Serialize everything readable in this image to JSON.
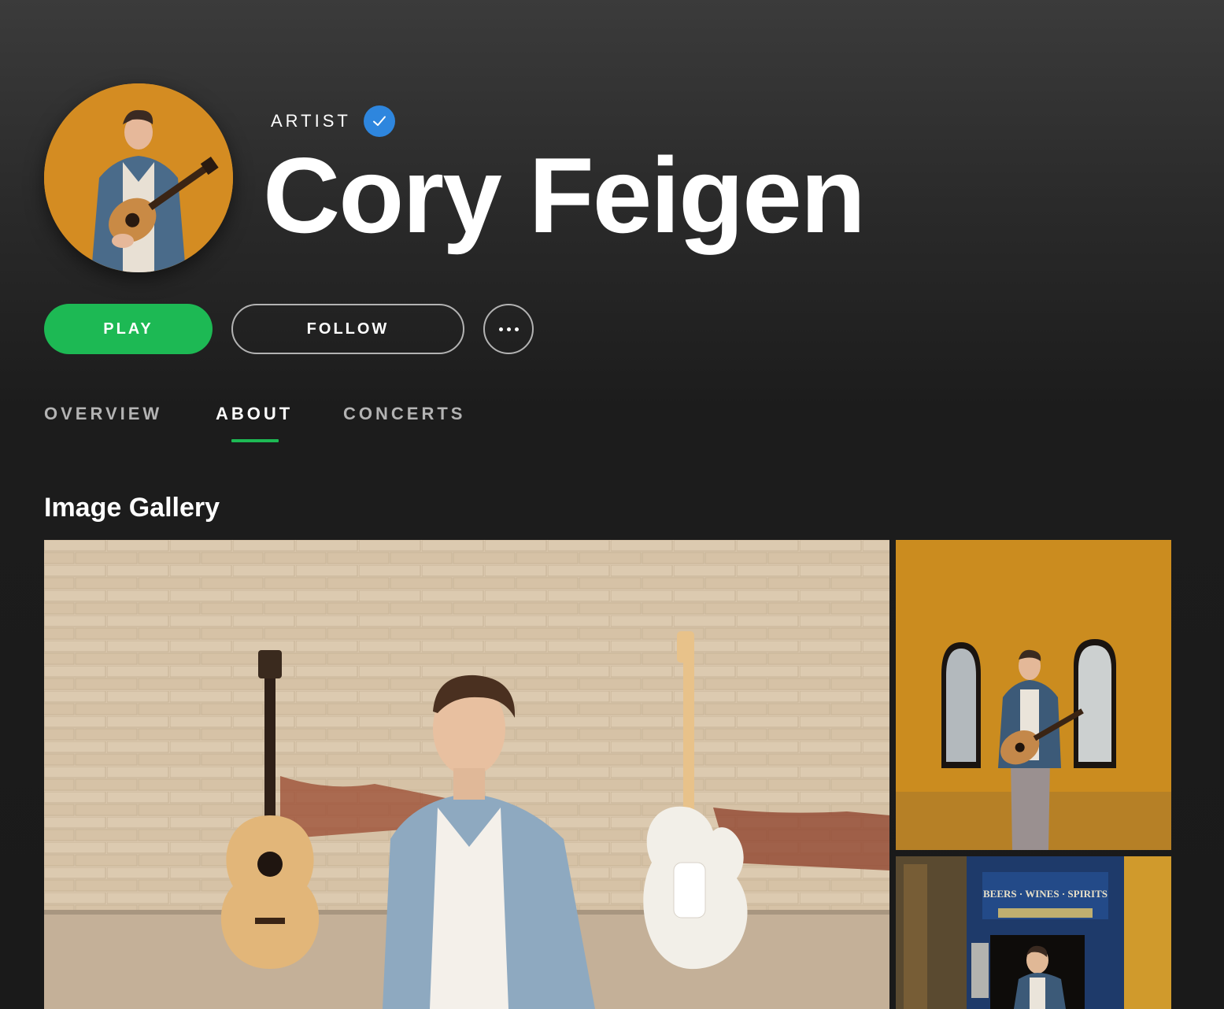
{
  "artist": {
    "type_label": "ARTIST",
    "verified": true,
    "name": "Cory Feigen"
  },
  "actions": {
    "play_label": "PLAY",
    "follow_label": "FOLLOW",
    "more_icon": "more-horizontal-icon"
  },
  "tabs": [
    {
      "label": "OVERVIEW",
      "active": false
    },
    {
      "label": "ABOUT",
      "active": true
    },
    {
      "label": "CONCERTS",
      "active": false
    }
  ],
  "gallery": {
    "title": "Image Gallery",
    "images": [
      {
        "description_icon": "photo-guitars-brick-wall"
      },
      {
        "description_icon": "photo-yellow-wall-windows"
      },
      {
        "description_icon": "photo-pub-storefront",
        "sign_text": "BEERS · WINES · SPIRITS"
      }
    ]
  },
  "colors": {
    "accent": "#1db954",
    "verified": "#2e86de",
    "background": "#1c1c1c",
    "muted_text": "#b3b3b3"
  }
}
